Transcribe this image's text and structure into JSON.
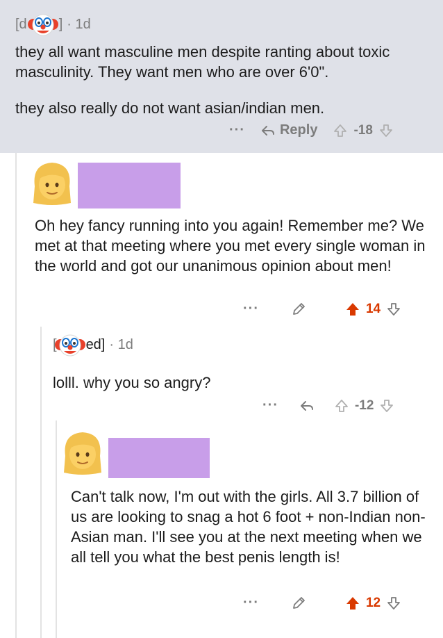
{
  "comment1": {
    "username_prefix": "[d",
    "username_suffix": "]",
    "age": "· 1d",
    "text1": "they all want masculine men despite ranting about toxic masculinity. They want men who are over 6'0\".",
    "text2": "they also really do not want asian/indian men.",
    "more": "···",
    "reply_label": "Reply",
    "score": "-18"
  },
  "comment2": {
    "text": "Oh hey fancy running into you again! Remember me? We met at that meeting where you met every single woman in the world and got our unanimous opinion about men!",
    "more": "···",
    "score": "14"
  },
  "comment3": {
    "username_prefix": "[",
    "username_suffix": "ed]",
    "age": "· 1d",
    "text": "lolll. why you so angry?",
    "more": "···",
    "score": "-12"
  },
  "comment4": {
    "text": "Can't talk now, I'm out with the girls. All 3.7 billion of us are looking to snag a hot 6 foot + non-Indian non-Asian man. I'll see you at the next meeting when we all tell you what the best penis length is!",
    "more": "···",
    "score": "12"
  },
  "colors": {
    "comment1_bg": "#dfe1e8",
    "redaction": "#c89ee9",
    "upvote_active": "#d93900",
    "muted": "#7c7c7c"
  },
  "icons": [
    "clown-face-emoji",
    "woman-emoji",
    "reply-arrow-icon",
    "upvote-icon",
    "downvote-icon",
    "pencil-icon",
    "more-options-icon"
  ]
}
